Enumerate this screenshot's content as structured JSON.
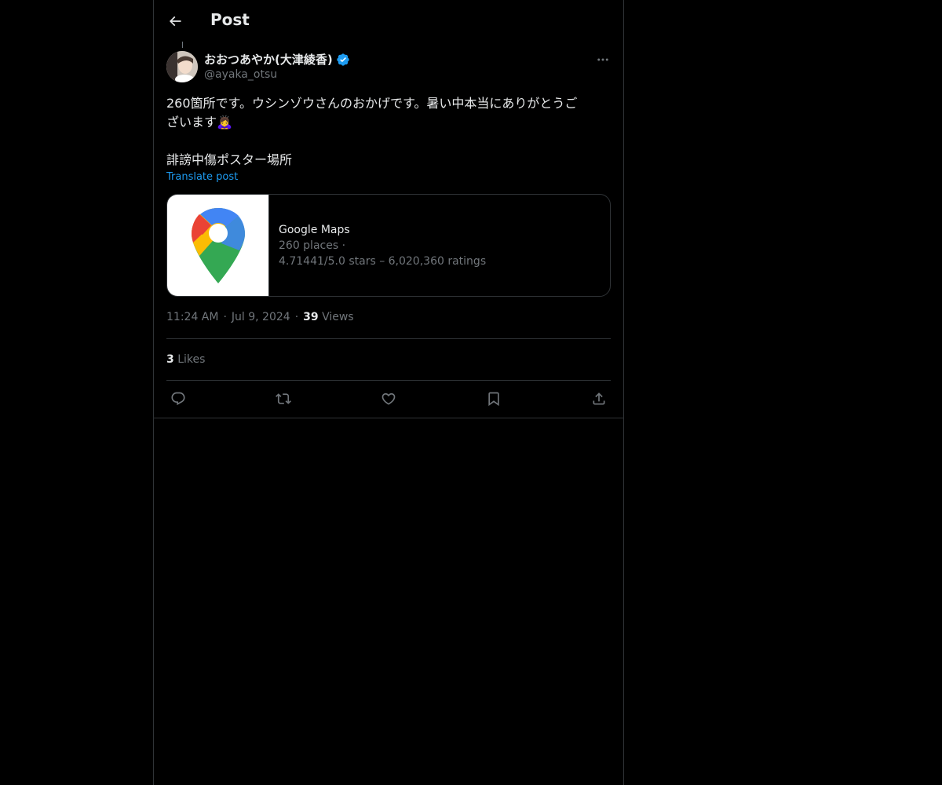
{
  "header": {
    "title": "Post"
  },
  "author": {
    "display_name": "おおつあやか(大津綾香)",
    "handle": "@ayaka_otsu",
    "verified": true
  },
  "post": {
    "text": "260箇所です。ウシンゾウさんのおかげです。暑い中本当にありがとうご\nざいます🙇‍♀️\n\n誹謗中傷ポスター場所",
    "translate_label": "Translate post"
  },
  "card": {
    "title": "Google Maps",
    "line1": "260 places ·",
    "line2": "4.71441/5.0 stars – 6,020,360 ratings"
  },
  "meta": {
    "time": "11:24 AM",
    "date": "Jul 9, 2024",
    "views_count": "39",
    "views_label": "Views",
    "sep": "·"
  },
  "engagement": {
    "likes_count": "3",
    "likes_label": "Likes"
  },
  "icons": {
    "back": "arrow-left-icon",
    "verified": "verified-badge-icon",
    "more": "more-horizontal-icon",
    "reply": "reply-icon",
    "repost": "repost-icon",
    "like": "heart-icon",
    "bookmark": "bookmark-icon",
    "share": "share-icon"
  },
  "colors": {
    "background": "#000000",
    "text": "#e7e9ea",
    "muted": "#71767b",
    "accent": "#1d9bf0",
    "border": "#2f3336"
  }
}
